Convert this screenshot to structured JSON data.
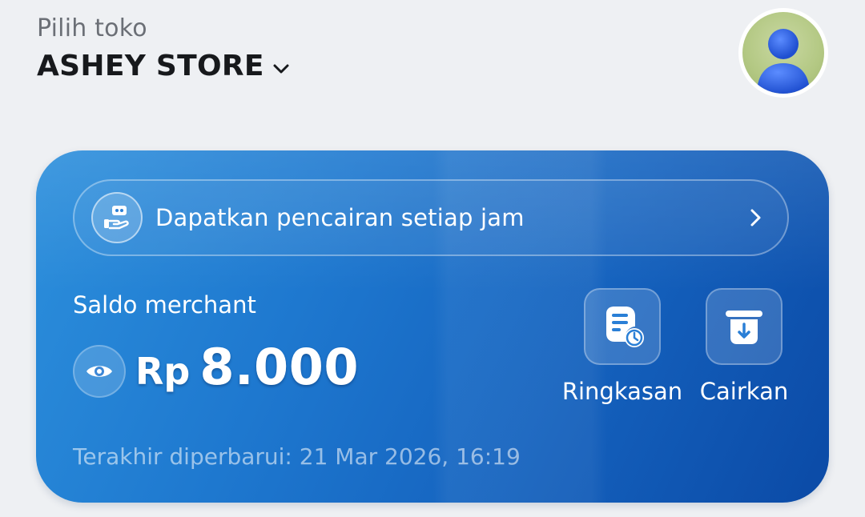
{
  "header": {
    "store_label": "Pilih toko",
    "store_name": "ASHEY STORE"
  },
  "card": {
    "promo_text": "Dapatkan pencairan setiap jam",
    "balance_label": "Saldo merchant",
    "currency": "Rp",
    "balance_value": "8.000",
    "actions": [
      {
        "label": "Ringkasan",
        "icon": "summary-clock-icon"
      },
      {
        "label": "Cairkan",
        "icon": "withdraw-icon"
      }
    ],
    "last_updated": "Terakhir diperbarui: 21 Mar 2026, 16:19"
  },
  "colors": {
    "card_start": "#2c8fdc",
    "card_end": "#0b4aa6",
    "background": "#eef0f3",
    "avatar_bg": "#b3c883",
    "avatar_figure": "#2f63e0"
  },
  "icons": [
    "chevron-down-icon",
    "avatar-icon",
    "hourly-payout-icon",
    "chevron-right-icon",
    "eye-icon",
    "summary-clock-icon",
    "withdraw-icon"
  ]
}
